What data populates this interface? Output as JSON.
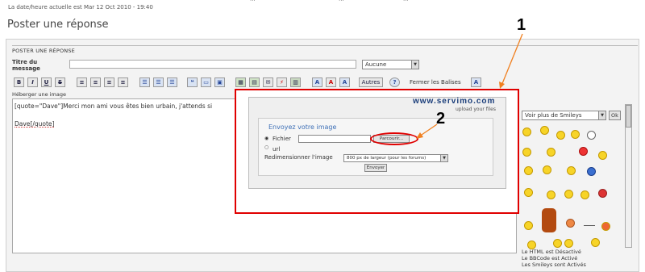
{
  "header": {
    "datetime": "La date/heure actuelle est Mar 12 Oct 2010 - 19:40",
    "cut_text_1": "...",
    "cut_text_2": "...",
    "cut_text_3": "..."
  },
  "page": {
    "title": "Poster une réponse"
  },
  "form": {
    "section_title": "POSTER UNE RÉPONSE",
    "titre_label": "Titre du message",
    "titre_value": "",
    "titre_select": "Aucune"
  },
  "toolbar": {
    "buttons": [
      "B",
      "I",
      "U",
      "S"
    ],
    "autres_label": "Autres",
    "fermer_label": "Fermer les Balises"
  },
  "host_label": "Héberger une image",
  "editor": {
    "line1": "[quote=\"Dave\"]Merci mon ami vous êtes bien urbain, j'attends si",
    "line2": "Dave[/quote]"
  },
  "servimo": {
    "brand": "www.servimo.com",
    "tagline": "upload your files",
    "title": "Envoyez votre image",
    "fichier_label": "Fichier",
    "url_label": "url",
    "browse_label": "Parcourir...",
    "resize_label": "Redimensionner l'image",
    "resize_value": "800 px de largeur (pour les forums)",
    "send_label": "Envoyer"
  },
  "callouts": {
    "one": "1",
    "two": "2"
  },
  "smileys": {
    "select_value": "Voir plus de Smileys",
    "ok_label": "Ok"
  },
  "status": {
    "html": "Le HTML est Désactivé",
    "bbcode": "Le BBCode est Activé",
    "smileys": "Les Smileys sont Activés"
  },
  "colors": {
    "highlight_red": "#e00000",
    "title_blue": "#3d6fb6"
  }
}
